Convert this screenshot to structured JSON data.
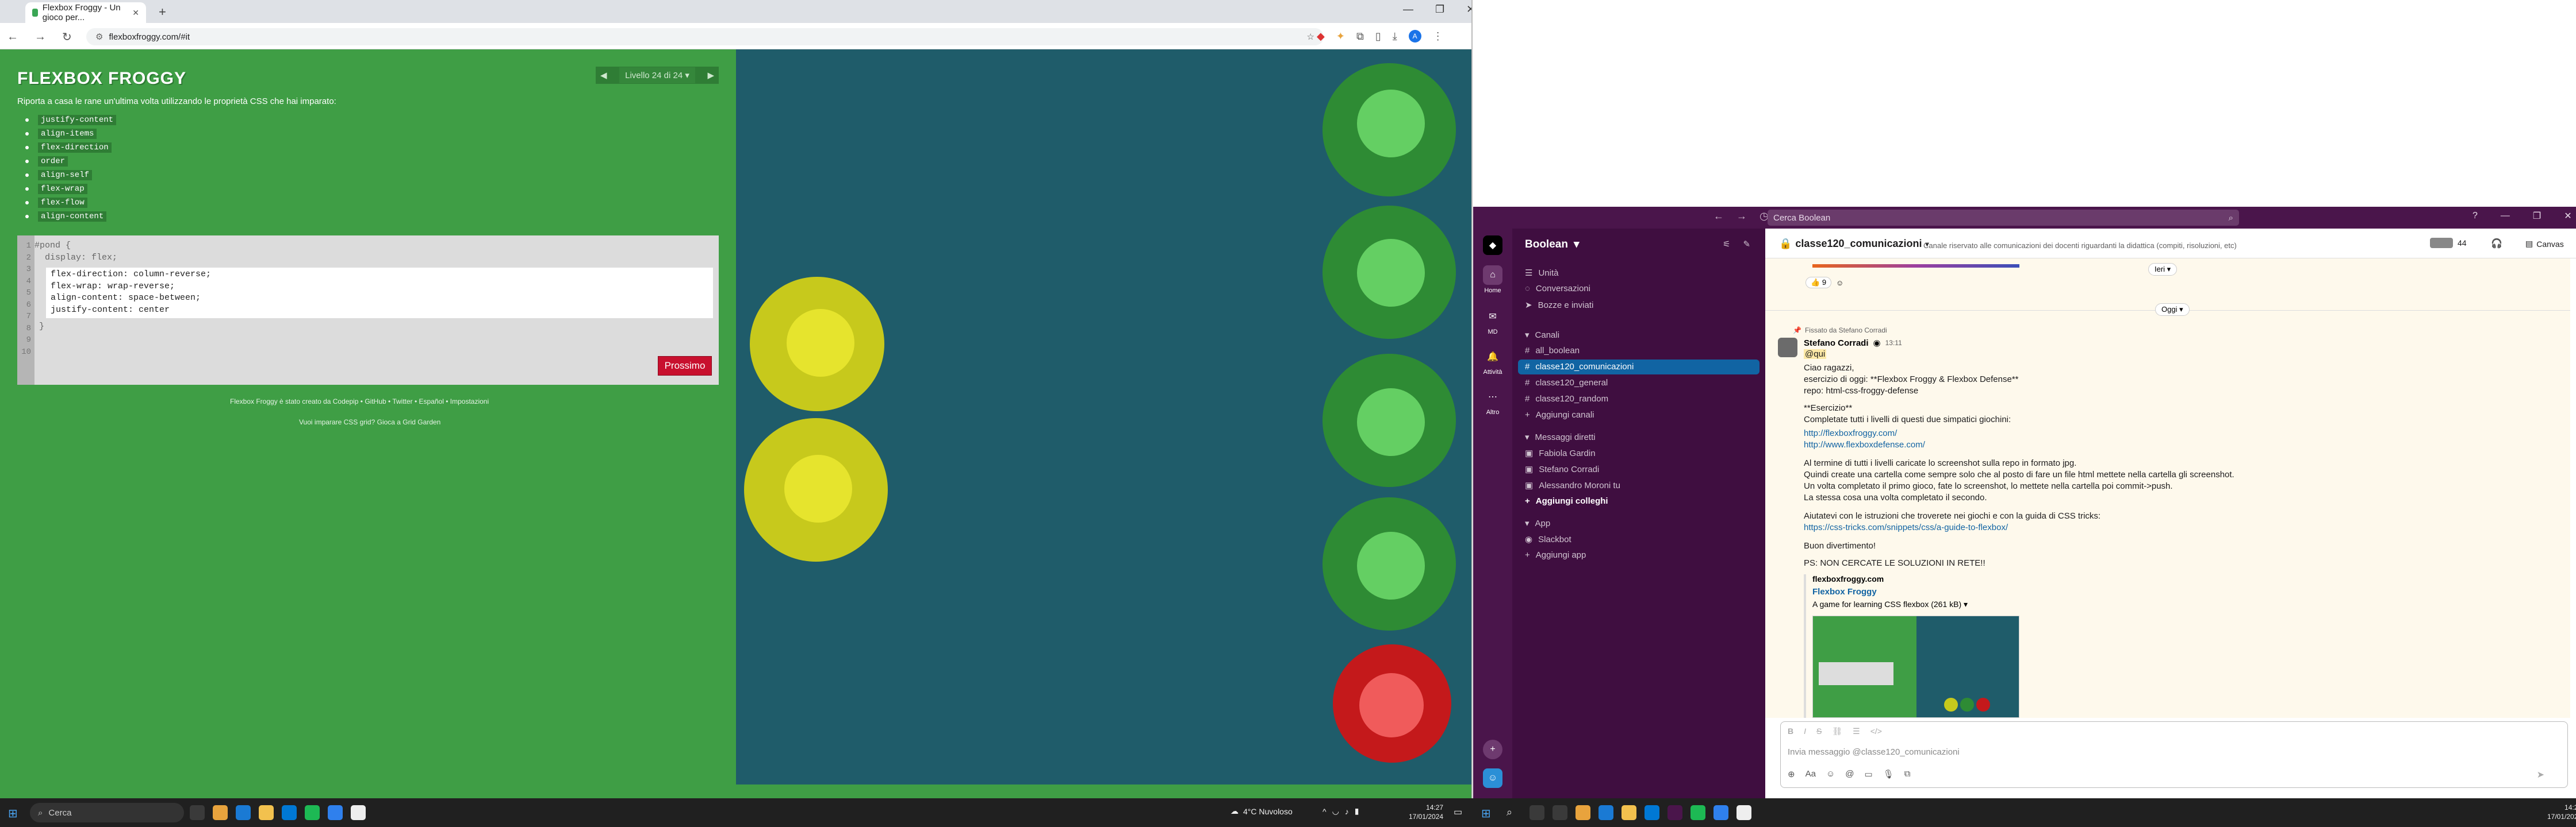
{
  "left_browser": {
    "tab_title": "Flexbox Froggy - Un gioco per...",
    "url": "flexboxfroggy.com/#it",
    "avatar": "A"
  },
  "froggy": {
    "title": "FLEXBOX FROGGY",
    "level_label": "Livello 24 di 24",
    "instructions": "Riporta a casa le rane un'ultima volta utilizzando le proprietà CSS che hai imparato:",
    "properties": [
      "justify-content",
      "align-items",
      "flex-direction",
      "order",
      "align-self",
      "flex-wrap",
      "flex-flow",
      "align-content"
    ],
    "line_numbers": [
      "1",
      "2",
      "3",
      "4",
      "5",
      "6",
      "7",
      "8",
      "9",
      "10"
    ],
    "code_before": [
      "#pond {",
      "  display: flex;"
    ],
    "code_input": [
      "flex-direction: column-reverse;",
      "flex-wrap: wrap-reverse;",
      "align-content: space-between;",
      "justify-content: center"
    ],
    "code_after": "}",
    "next_label": "Prossimo",
    "footer_text": "Flexbox Froggy è stato creato da Codepip • GitHub • Twitter • Español • Impostazioni",
    "settings_label": "Impostazioni",
    "footer_text2": "Vuoi imparare CSS grid? Gioca a Grid Garden"
  },
  "slack": {
    "search_placeholder": "Cerca Boolean",
    "workspace": "Boolean",
    "rail": [
      {
        "label": "Home"
      },
      {
        "label": "MD"
      },
      {
        "label": "Attività"
      },
      {
        "label": "Altro"
      }
    ],
    "side_top": [
      "Unità",
      "Conversazioni",
      "Bozze e inviati"
    ],
    "channels_header": "Canali",
    "channels": [
      "all_boolean",
      "classe120_comunicazioni",
      "classe120_general",
      "classe120_random",
      "Aggiungi canali"
    ],
    "dms_header": "Messaggi diretti",
    "dms": [
      "Fabiola Gardin",
      "Stefano Corradi",
      "Alessandro Moroni  tu",
      "Aggiungi colleghi"
    ],
    "apps_header": "App",
    "apps": [
      "Slackbot",
      "Aggiungi app"
    ],
    "channel_name": "classe120_comunicazioni",
    "channel_desc": "Canale riservato alle comunicazioni dei docenti riguardanti la didattica (compiti, risoluzioni, etc)",
    "member_count": "44",
    "canvas_label": "Canvas",
    "ieri": "Ieri",
    "oggi": "Oggi",
    "reaction_count": "9",
    "pinned_by": "Fissato da Stefano Corradi",
    "author": "Stefano Corradi",
    "time": "13:11",
    "mention": "@qui",
    "lines": [
      "Ciao ragazzi,",
      "esercizio di oggi: **Flexbox Froggy & Flexbox Defense**",
      "repo: html-css-froggy-defense",
      "**Esercizio**",
      "Completate tutti i livelli di questi due simpatici giochini:",
      "http://flexboxfroggy.com/",
      "http://www.flexboxdefense.com/",
      "Al termine di tutti i livelli caricate lo screenshot sulla repo in formato jpg.",
      "Quindi create una cartella come sempre solo che al posto di fare un file html mettete nella cartella gli screenshot.",
      "Un volta completato il primo gioco, fate lo screenshot, lo mettete nella cartella poi commit->push.",
      "La stessa cosa una volta completato il secondo.",
      "Aiutatevi con le istruzioni che troverete nei giochi e con la guida di CSS tricks:",
      "https://css-tricks.com/snippets/css/a-guide-to-flexbox/",
      "Buon divertimento!",
      "PS: NON CERCATE LE SOLUZIONI IN RETE!!"
    ],
    "unfurl_site": "flexboxfroggy.com",
    "unfurl_title": "Flexbox Froggy",
    "unfurl_desc": "A game for learning CSS flexbox (261 kB) ▾",
    "composer_placeholder": "Invia messaggio @classe120_comunicazioni"
  },
  "taskbar": {
    "search": "Cerca",
    "weather": "4°C  Nuvoloso",
    "time_left": "14:27",
    "date_left": "17/01/2024",
    "time_right": "14:27",
    "date_right": "17/01/2024"
  },
  "colors": {
    "pond": "#1f5c6a",
    "grass": "#3f9e45",
    "slack_purple": "#4a154b",
    "slack_sidebar": "#3f0e40",
    "selected": "#1164a3"
  }
}
